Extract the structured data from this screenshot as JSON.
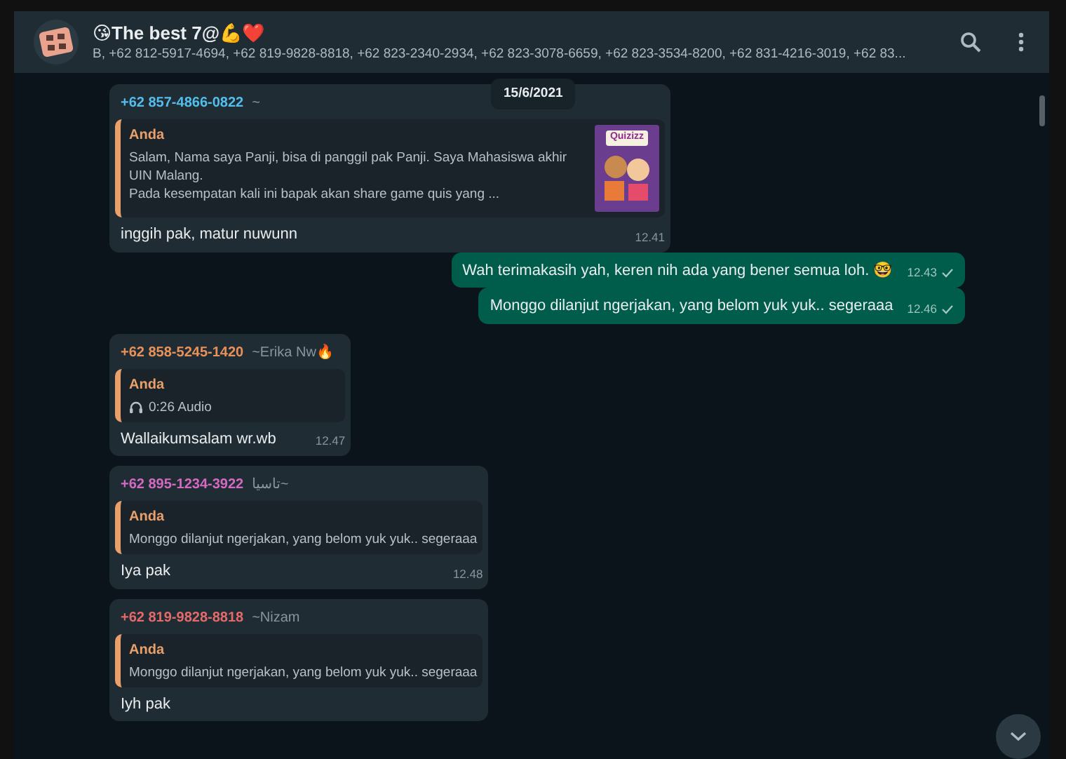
{
  "header": {
    "title": "😘The best 7@💪❤️",
    "participants": "B, +62 812-5917-4694, +62 819-9828-8818, +62 823-2340-2934, +62 823-3078-6659, +62 823-3534-8200, +62 831-4216-3019, +62 83..."
  },
  "date_badge": "15/6/2021",
  "messages": [
    {
      "kind": "incoming",
      "sender": "+62 857-4866-0822",
      "color": "#53bdeb",
      "push_name": "~",
      "quote": {
        "author": "Anda",
        "kind": "image",
        "lines": [
          "Salam, Nama saya Panji, bisa di panggil pak Panji. Saya Mahasiswa akhir UIN Malang.",
          "Pada kesempatan kali ini bapak akan share game quis yang ..."
        ],
        "thumb_label": "Quizizz"
      },
      "text": "inggih pak, matur nuwunn",
      "time": "12.41"
    },
    {
      "kind": "outgoing",
      "text": "Wah terimakasih yah, keren nih ada yang bener semua loh. 🤓",
      "time": "12.43"
    },
    {
      "kind": "outgoing",
      "text": "Monggo dilanjut ngerjakan, yang belom yuk yuk.. segeraaa",
      "time": "12.46"
    },
    {
      "kind": "incoming",
      "sender": "+62 858-5245-1420",
      "color": "#e8925a",
      "push_name": "~Erika Nw🔥",
      "quote": {
        "author": "Anda",
        "kind": "audio",
        "lines": [
          "0:26 Audio"
        ]
      },
      "text": "Wallaikumsalam wr.wb",
      "time": "12.47"
    },
    {
      "kind": "incoming",
      "sender": "+62 895-1234-3922",
      "color": "#d36ac2",
      "push_name": "~تاسيا",
      "quote": {
        "author": "Anda",
        "kind": "text",
        "lines": [
          "Monggo dilanjut ngerjakan, yang belom yuk yuk.. segeraaa"
        ]
      },
      "text": "Iya pak",
      "time": "12.48"
    },
    {
      "kind": "incoming",
      "sender": "+62 819-9828-8818",
      "color": "#e26a6a",
      "push_name": "~Nizam",
      "quote": {
        "author": "Anda",
        "kind": "text",
        "lines": [
          "Monggo dilanjut ngerjakan, yang belom yuk yuk.. segeraaa"
        ]
      },
      "text": "Iyh pak"
    }
  ]
}
